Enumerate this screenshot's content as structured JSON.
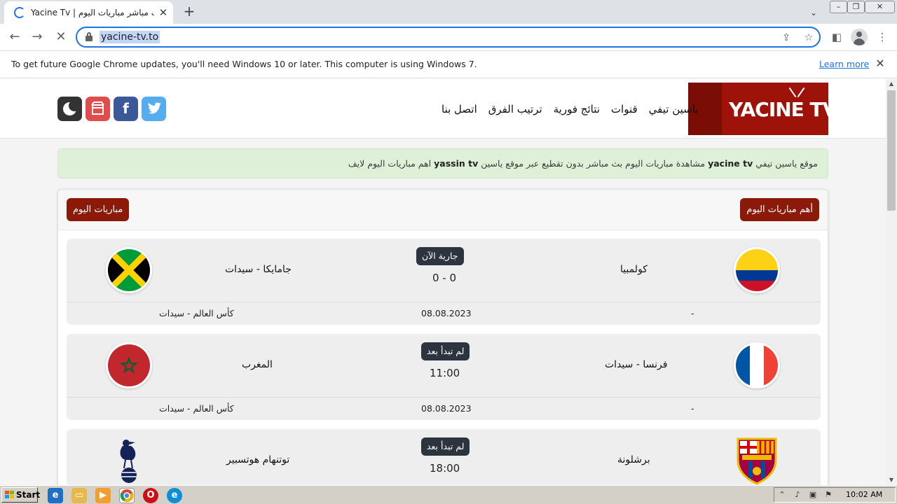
{
  "browser": {
    "tab_title": "Yacine Tv | ياسين بث مباشر مباريات اليوم",
    "tab_close": "✕",
    "new_tab": "+",
    "url": "yacine-tv.to",
    "info_bar_text": "To get future Google Chrome updates, you'll need Windows 10 or later. This computer is using Windows 7.",
    "info_bar_link": "Learn more",
    "info_bar_close": "✕"
  },
  "site": {
    "logo_text": "YACINE TV",
    "nav": [
      "ياسين تيفي",
      "قنوات",
      "نتائج فورية",
      "ترتيب الفرق",
      "اتصل بنا"
    ],
    "notice": {
      "part1": "موقع ياسين تيفي",
      "brand1": "yacine tv",
      "part2": "مشاهدة مباريات اليوم بث مباشر بدون تقطيع عبر موقع ياسين",
      "brand2": "yassin tv",
      "part3": "اهم مباريات اليوم لايف"
    },
    "section_title": "أهم مباريات اليوم",
    "today_button": "مباريات اليوم",
    "matches": [
      {
        "home": "كولمبيا",
        "away": "جامايكا - سيدات",
        "status": "جارية الآن",
        "score": "0 - 0",
        "date": "08.08.2023",
        "competition": "كأس العالم - سيدات",
        "channel": "-"
      },
      {
        "home": "فرنسا - سيدات",
        "away": "المغرب",
        "status": "لم تبدأ بعد",
        "score": "11:00",
        "date": "08.08.2023",
        "competition": "كأس العالم - سيدات",
        "channel": "-"
      },
      {
        "home": "برشلونة",
        "away": "توتنهام هوتسبير",
        "status": "لم تبدأ بعد",
        "score": "18:00",
        "date": "",
        "competition": "",
        "channel": ""
      }
    ]
  },
  "taskbar": {
    "start_label": "Start",
    "clock": "10:02 AM"
  },
  "colors": {
    "brand_red": "#9e1309",
    "button_red": "#8b1a0b",
    "notice_green": "#dff0d8",
    "status_dark": "#2c3440",
    "chrome_blue": "#1a73e8"
  }
}
